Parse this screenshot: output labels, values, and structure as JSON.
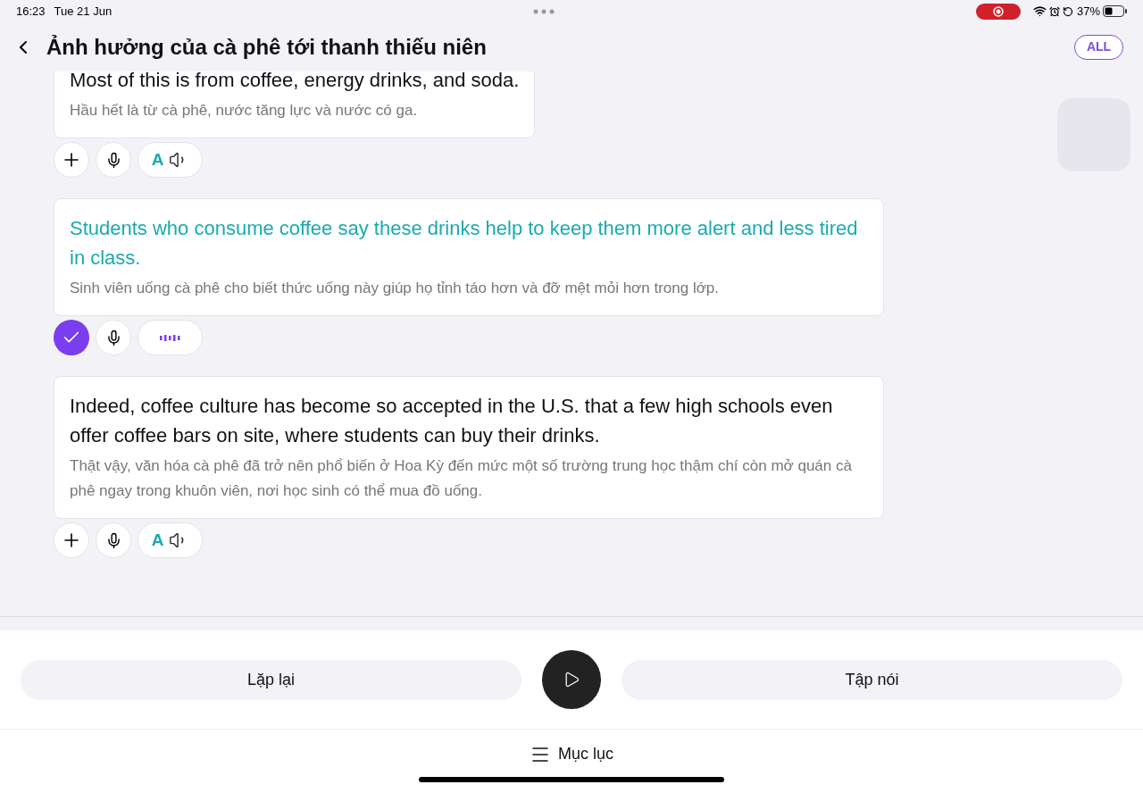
{
  "status_bar": {
    "time": "16:23",
    "date": "Tue 21 Jun",
    "battery": "37%"
  },
  "header": {
    "title": "Ảnh hưởng của cà phê tới thanh thiếu niên",
    "filter": "ALL"
  },
  "sentences": [
    {
      "english": "Most of this is from coffee, energy drinks, and soda.",
      "vietnamese": "Hầu hết là từ cà phê, nước tăng lực và nước có ga.",
      "highlighted": false,
      "done": false,
      "playing": false,
      "voice_label": "A"
    },
    {
      "english": "Students who consume coffee say these drinks help to keep them more alert and less tired in class.",
      "vietnamese": "Sinh viên uống cà phê cho biết thức uống này giúp họ tỉnh táo hơn và đỡ mệt mỏi hơn trong lớp.",
      "highlighted": true,
      "done": true,
      "playing": true
    },
    {
      "english": "Indeed, coffee culture has become so accepted in the U.S. that a few high schools even offer coffee bars on site, where students can buy their drinks.",
      "vietnamese": "Thật vậy, văn hóa cà phê đã trở nên phổ biến ở Hoa Kỳ đến mức một số trường trung học thậm chí còn mở quán cà phê ngay trong khuôn viên, nơi học sinh có thể mua đồ uống.",
      "highlighted": false,
      "done": false,
      "playing": false,
      "voice_label": "A"
    }
  ],
  "controls": {
    "repeat": "Lặp lại",
    "practice": "Tập nói"
  },
  "footer": {
    "contents": "Mục lục"
  }
}
